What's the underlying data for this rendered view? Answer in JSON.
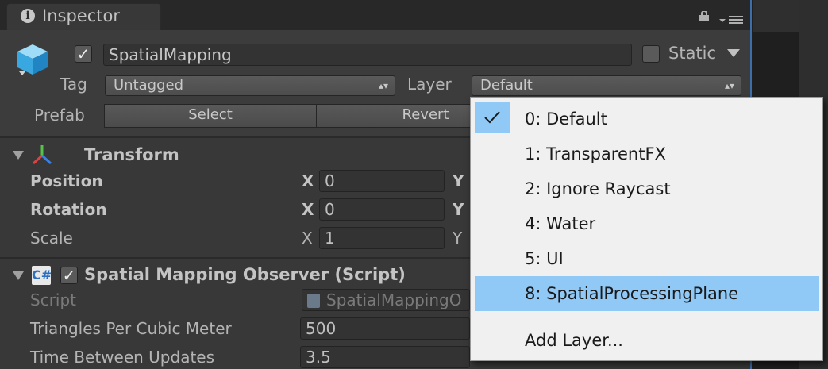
{
  "tab": {
    "title": "Inspector"
  },
  "header": {
    "object_name": "SpatialMapping",
    "active": true,
    "static_label": "Static",
    "static_checked": false,
    "tag_label": "Tag",
    "tag_value": "Untagged",
    "layer_label": "Layer",
    "layer_value": "Default",
    "prefab_label": "Prefab",
    "prefab_select": "Select",
    "prefab_revert": "Revert"
  },
  "transform": {
    "title": "Transform",
    "position_label": "Position",
    "rotation_label": "Rotation",
    "scale_label": "Scale",
    "x_label": "X",
    "y_label": "Y",
    "position_x": "0",
    "rotation_x": "0",
    "scale_x": "1"
  },
  "script": {
    "title": "Spatial Mapping Observer (Script)",
    "script_label": "Script",
    "script_value": "SpatialMappingO",
    "triangles_label": "Triangles Per Cubic Meter",
    "triangles_value": "500",
    "time_label": "Time Between Updates",
    "time_value": "3.5"
  },
  "layer_dropdown": {
    "items": [
      {
        "label": "0: Default",
        "checked": true
      },
      {
        "label": "1: TransparentFX"
      },
      {
        "label": "2: Ignore Raycast"
      },
      {
        "label": "4: Water"
      },
      {
        "label": "5: UI"
      },
      {
        "label": "8: SpatialProcessingPlane",
        "highlighted": true
      }
    ],
    "add_layer": "Add Layer..."
  },
  "colors": {
    "panel_bg": "#383838",
    "highlight": "#90c8f6",
    "dropdown_bg": "#f0f0f0",
    "accent_blue": "#3d6ea8"
  }
}
